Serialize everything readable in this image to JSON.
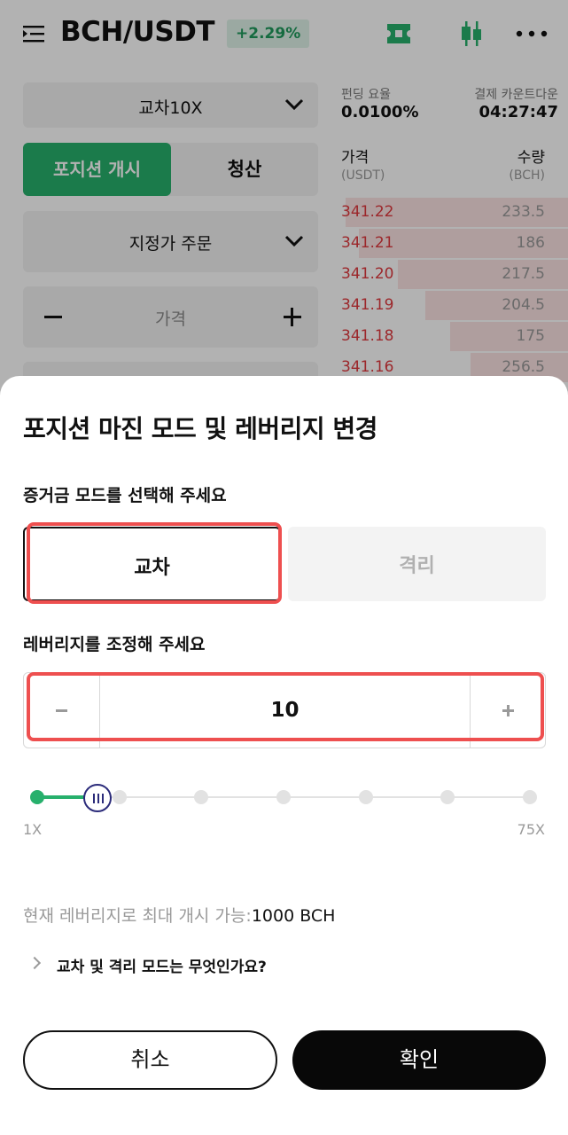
{
  "header": {
    "pair": "BCH/USDT",
    "change": "+2.29%",
    "icons": [
      "menu-icon",
      "ticket-icon",
      "candlestick-chart-icon",
      "more-icon"
    ]
  },
  "form": {
    "leverage_select": "교차10X",
    "open_tab": "포지션 개시",
    "close_tab": "청산",
    "order_type": "지정가 주문",
    "price_placeholder": "가격"
  },
  "funding": {
    "rate_label": "펀딩 요율",
    "rate_value": "0.0100%",
    "countdown_label": "결제 카운트다운",
    "countdown_value": "04:27:47"
  },
  "orderbook": {
    "price_header": "가격",
    "price_unit": "(USDT)",
    "qty_header": "수량",
    "qty_unit": "(BCH)",
    "rows": [
      {
        "price": "341.22",
        "qty": "233.5",
        "depth": 0.98
      },
      {
        "price": "341.21",
        "qty": "186",
        "depth": 0.92
      },
      {
        "price": "341.20",
        "qty": "217.5",
        "depth": 0.75
      },
      {
        "price": "341.19",
        "qty": "204.5",
        "depth": 0.63
      },
      {
        "price": "341.18",
        "qty": "175",
        "depth": 0.52
      },
      {
        "price": "341.16",
        "qty": "256.5",
        "depth": 0.43
      }
    ]
  },
  "sheet": {
    "title": "포지션 마진 모드 및 레버리지 변경",
    "margin_label": "증거금 모드를 선택해 주세요",
    "mode_cross": "교차",
    "mode_isolated": "격리",
    "selected_mode": "교차",
    "leverage_label": "레버리지를 조정해 주세요",
    "leverage_value": "10",
    "leverage_min_label": "1X",
    "leverage_max_label": "75X",
    "leverage_min": 1,
    "leverage_max": 75,
    "max_open_label": "현재 레버리지로 최대 개시 가능:",
    "max_open_value": "1000 BCH",
    "faq": "교차 및 격리 모드는 무엇인가요?",
    "cancel": "취소",
    "confirm": "확인"
  },
  "colors": {
    "accent_green": "#27b06c",
    "ask_red": "#e0393e",
    "highlight_red": "#ee4f4f"
  }
}
